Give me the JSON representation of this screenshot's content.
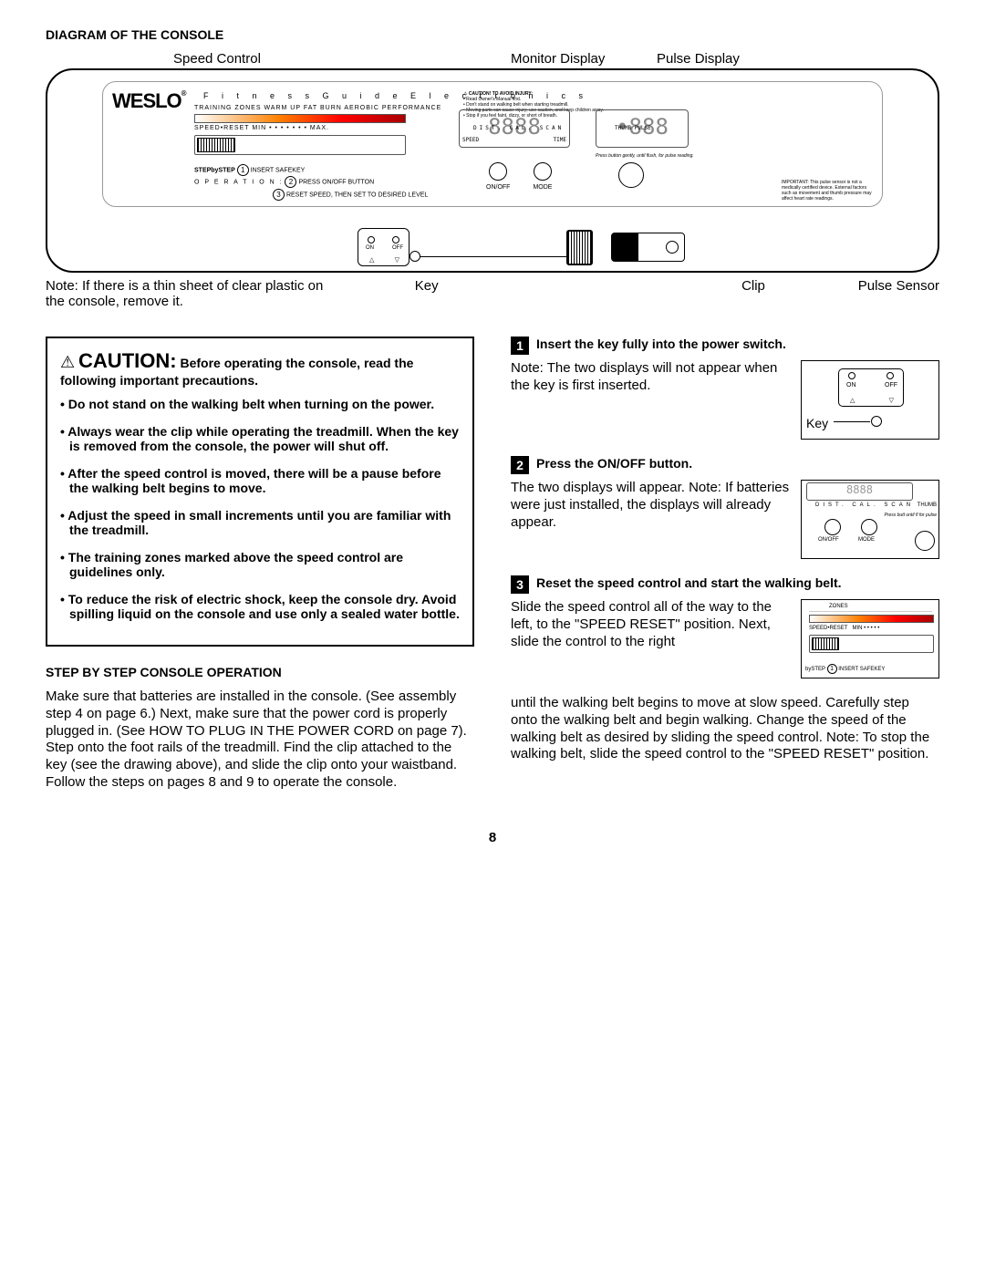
{
  "heading": "DIAGRAM OF THE CONSOLE",
  "labels": {
    "speed_control": "Speed Control",
    "monitor_display": "Monitor Display",
    "pulse_display": "Pulse Display",
    "note_below": "Note: If there is a thin sheet of clear plastic on the console, remove it.",
    "key": "Key",
    "clip": "Clip",
    "pulse_sensor": "Pulse Sensor"
  },
  "console": {
    "brand": "WESLO",
    "reg": "®",
    "tagline": "F i t n e s s   G u i d e   E l e c t r o n i c s",
    "training_row": "TRAINING ZONES    WARM UP    FAT BURN    AEROBIC    PERFORMANCE",
    "speed_row": "SPEED•RESET    MIN   •   •   •   •   •   •   • MAX.",
    "step_label": "STEPbySTEP",
    "op_label": "O P E R A T I O N :",
    "step1": "INSERT SAFEKEY",
    "step2": "PRESS ON/OFF BUTTON",
    "step3": "RESET SPEED, THEN SET TO DESIRED LEVEL",
    "display1_left": "SPEED",
    "display1_right": "TIME",
    "display1_value": "8888",
    "display1_sub": "DIST.    CAL.    SCAN",
    "display2_label": "THUMB PULSE",
    "display2_value": "•888",
    "btn_onoff": "ON/OFF",
    "btn_mode": "MODE",
    "key_on": "ON",
    "key_off": "OFF",
    "caution_hdr": "CAUTION! TO AVOID INJURY:",
    "caution_b1": "• Read Owner's Manual first.",
    "caution_b2": "• Don't stand on walking belt when starting treadmill.",
    "caution_b3": "• Moving parts can cause injury; use caution, and keep children away.",
    "caution_b4": "• Stop if you feel faint, dizzy, or short of breath.",
    "thumb_instr": "Press button gently, until flush, for pulse reading.",
    "pulse_disclaimer": "IMPORTANT: This pulse sensor is not a medically certified device. External factors such as movement and thumb pressure may affect heart rate readings."
  },
  "caution_box": {
    "title": "CAUTION:",
    "lead": "Before operating the console, read the following important precautions.",
    "bullets": [
      "Do not stand on the walking belt when turning on the power.",
      "Always wear the clip while operating the treadmill. When the key is removed from the console, the power will shut off.",
      "After the speed control is moved, there will be a pause before the walking belt begins to move.",
      "Adjust the speed in small increments until you are familiar with the treadmill.",
      "The training zones marked above the speed control are guidelines only.",
      "To reduce the risk of electric shock, keep the console dry. Avoid spilling liquid on the console and use only a sealed water bottle."
    ]
  },
  "subsection": {
    "title": "STEP BY STEP CONSOLE OPERATION",
    "para": "Make sure that batteries are installed in the console. (See assembly step 4 on page 6.) Next, make sure that the power cord is properly plugged in. (See HOW TO PLUG IN THE POWER CORD on page 7). Step onto the foot rails of the treadmill. Find the clip attached to the key (see the drawing above), and slide the clip onto your waistband. Follow the steps on pages 8 and 9 to operate the console."
  },
  "steps": [
    {
      "num": "1",
      "title": "Insert the key fully into the power switch.",
      "text": "Note: The two displays will not appear when the key is first inserted.",
      "fig_key": "Key"
    },
    {
      "num": "2",
      "title": "Press the ON/OFF button.",
      "text": "The two displays will appear. Note: If batteries were just installed, the displays will already appear.",
      "fig_labels": {
        "dist": "DIST.",
        "cal": "CAL.",
        "scan": "SCAN",
        "thumb": "THUMB",
        "onoff": "ON/OFF",
        "mode": "MODE",
        "hint": "Press butt until fl for pulse"
      }
    },
    {
      "num": "3",
      "title": "Reset the speed control and start the walking belt.",
      "text": "Slide the speed control all of the way to the left, to the \"SPEED RESET\" position. Next, slide the control to the right",
      "text_cont": "until the walking belt begins to move at slow speed. Carefully step onto the walking belt and begin walking. Change the speed of the walking belt as desired by sliding the speed control. Note: To stop the walking belt, slide the speed control to the \"SPEED RESET\" position.",
      "fig_labels": {
        "zones": "ZONES",
        "reset": "SPEED•RESET",
        "min": "MIN  •  •  •  •  •",
        "step": "bySTEP",
        "safekey": "INSERT SAFEKEY"
      }
    }
  ],
  "page_number": "8"
}
